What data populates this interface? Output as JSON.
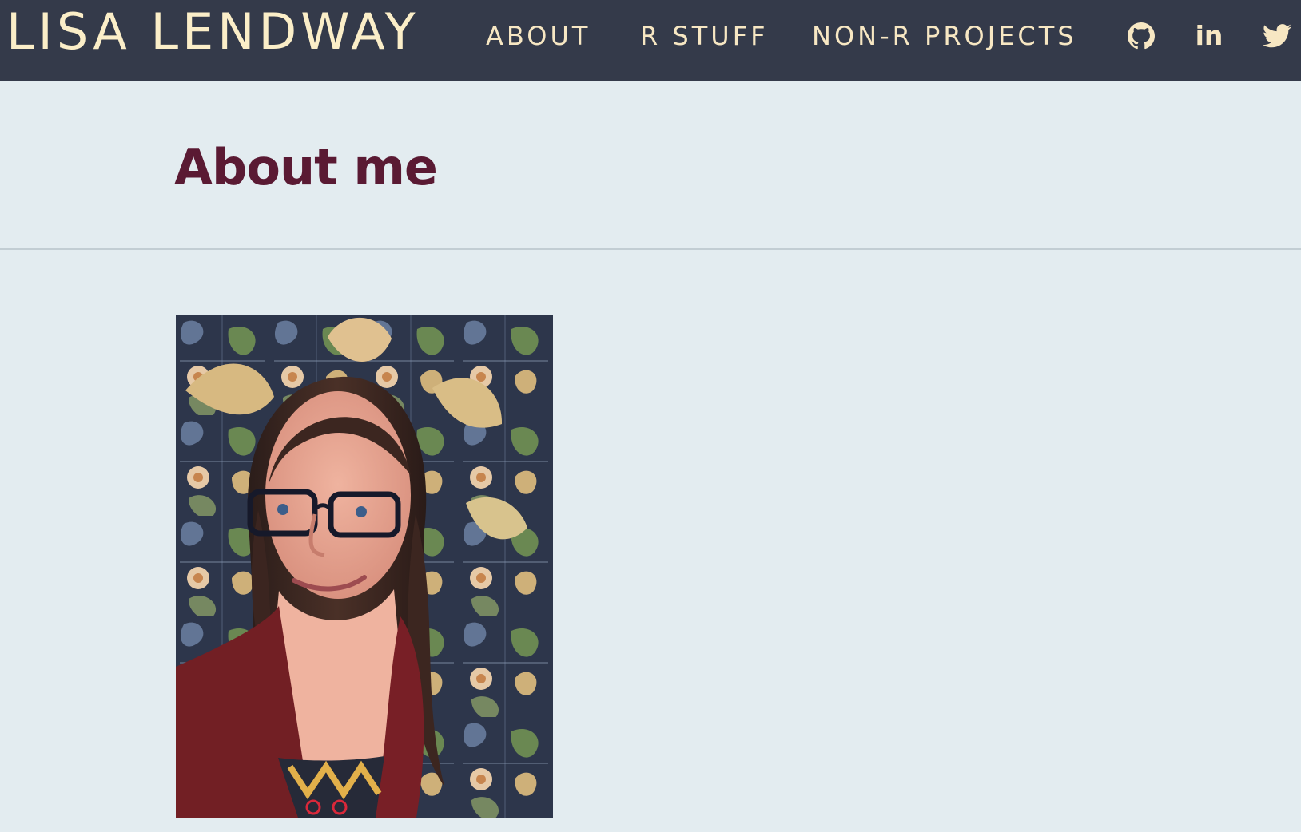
{
  "header": {
    "brand": "LISA LENDWAY",
    "nav": {
      "about": "ABOUT",
      "r_stuff": "R STUFF",
      "non_r_projects": "NON-R PROJECTS"
    },
    "icons": [
      "github-icon",
      "linkedin-icon",
      "twitter-icon"
    ],
    "linkedin_glyph": "in"
  },
  "main": {
    "title": "About me"
  },
  "colors": {
    "navbar_bg": "#343a4a",
    "nav_text": "#f7e7c3",
    "page_bg": "#e3ecf0",
    "title": "#5a1a33"
  }
}
